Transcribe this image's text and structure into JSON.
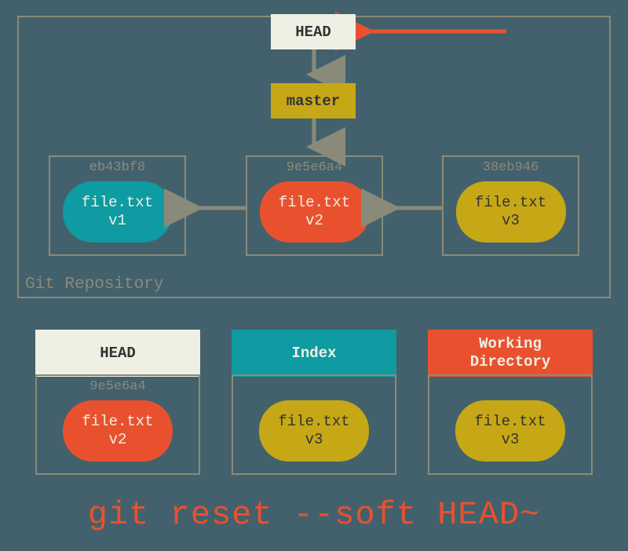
{
  "repo_label": "Git Repository",
  "head_label": "HEAD",
  "master_label": "master",
  "commits": [
    {
      "hash": "eb43bf8",
      "file": "file.txt",
      "version": "v1"
    },
    {
      "hash": "9e5e6a4",
      "file": "file.txt",
      "version": "v2"
    },
    {
      "hash": "38eb946",
      "file": "file.txt",
      "version": "v3"
    }
  ],
  "bottom": {
    "head": {
      "label": "HEAD",
      "hash": "9e5e6a4",
      "file": "file.txt",
      "version": "v2"
    },
    "index": {
      "label": "Index",
      "file": "file.txt",
      "version": "v3"
    },
    "wd": {
      "label": "Working\nDirectory",
      "file": "file.txt",
      "version": "v3"
    }
  },
  "command": "git reset --soft HEAD~",
  "colors": {
    "bg": "#43616c",
    "box_border": "#8a8a7a",
    "cream": "#f0efe4",
    "teal": "#0e9ba1",
    "orange": "#e9512e",
    "olive": "#c6a816"
  }
}
